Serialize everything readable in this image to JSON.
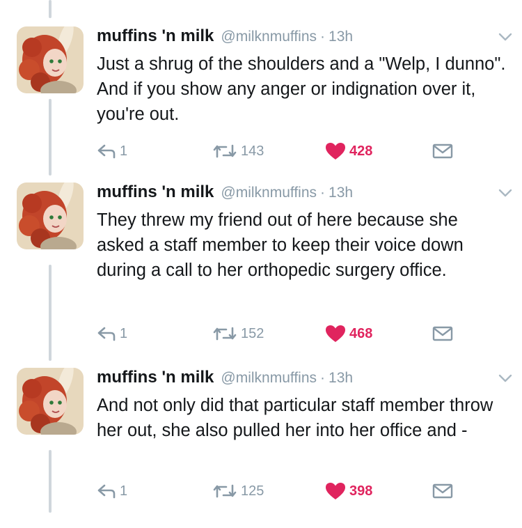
{
  "colors": {
    "text": "#14171a",
    "muted": "#8899a6",
    "like": "#e0245e",
    "thread_line": "#cfd6dc"
  },
  "tweets": [
    {
      "name": "muffins 'n milk",
      "handle": "@milknmuffins",
      "time": "13h",
      "text": "Just a shrug of the shoulders and a \"Welp, I dunno\". And if you show any anger or indignation over it, you're out.",
      "replies": "1",
      "retweets": "143",
      "likes": "428"
    },
    {
      "name": "muffins 'n milk",
      "handle": "@milknmuffins",
      "time": "13h",
      "text": "They threw my friend out of here because she asked a staff member to keep their voice down during a call to her orthopedic surgery office.",
      "replies": "1",
      "retweets": "152",
      "likes": "468"
    },
    {
      "name": "muffins 'n milk",
      "handle": "@milknmuffins",
      "time": "13h",
      "text": "And not only did that particular staff member throw her out, she also pulled her into her office and -",
      "replies": "1",
      "retweets": "125",
      "likes": "398"
    }
  ],
  "icons": {
    "reply": "reply-icon",
    "retweet": "retweet-icon",
    "like": "heart-icon",
    "dm": "direct-message-icon",
    "more": "chevron-down-icon"
  }
}
